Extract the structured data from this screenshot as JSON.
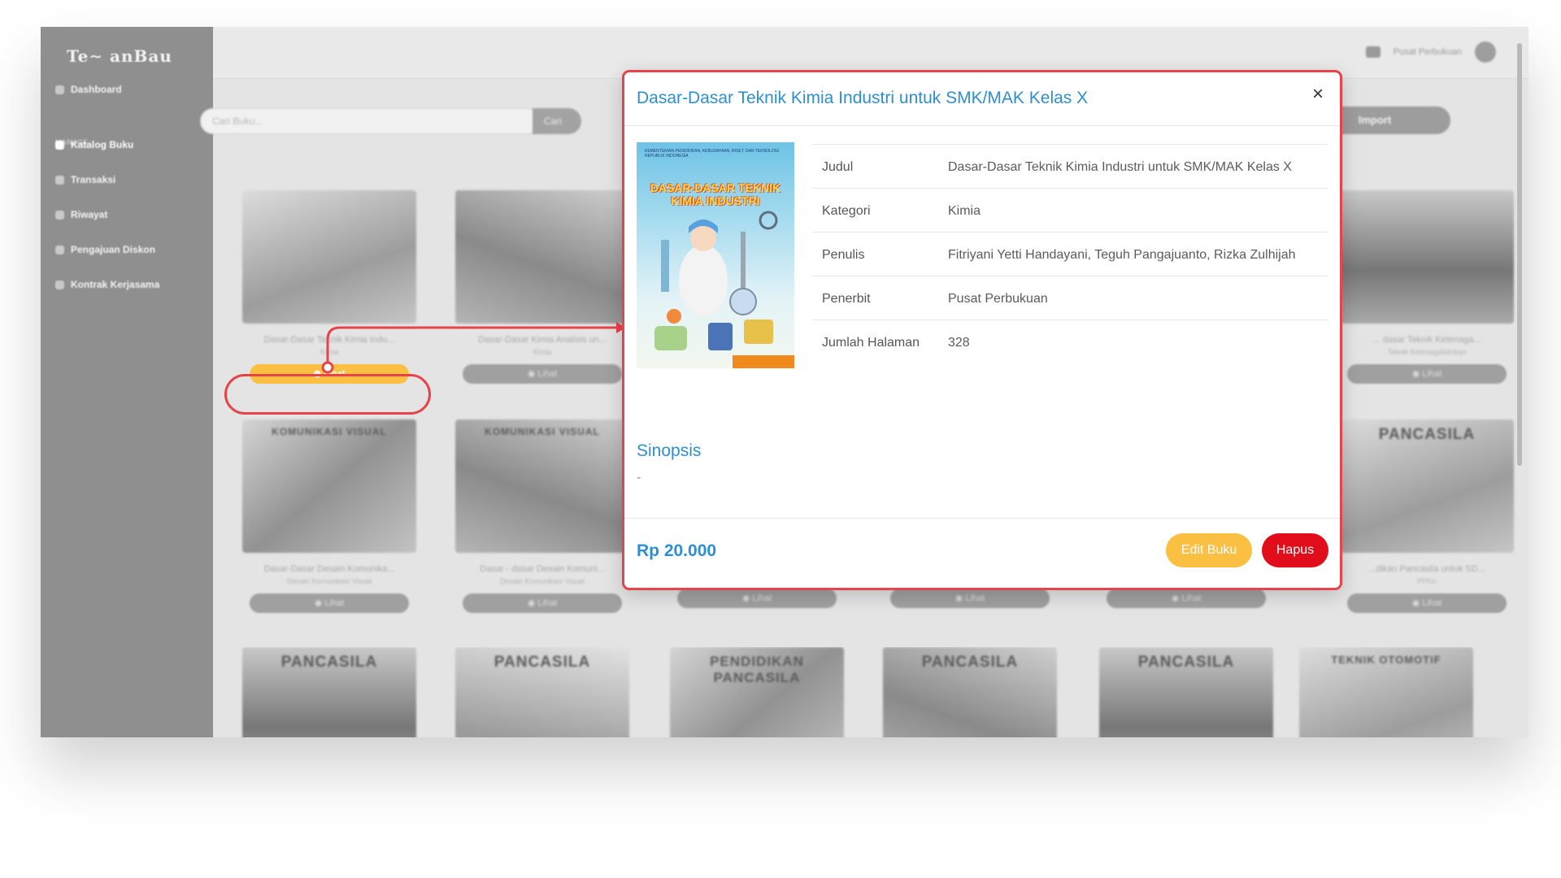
{
  "app": {
    "logo_text": "Te∼ anBau"
  },
  "sidebar": {
    "items": [
      {
        "label": "Dashboard",
        "active": false
      },
      {
        "label": "Katalog Buku",
        "active": true
      },
      {
        "label": "Transaksi",
        "active": false
      },
      {
        "label": "Riwayat",
        "active": false
      },
      {
        "label": "Pengajuan Diskon",
        "active": false
      },
      {
        "label": "Kontrak Kerjasama",
        "active": false
      }
    ],
    "section_label": "MANAGE"
  },
  "topbar": {
    "user_name": "Pusat Perbukuan"
  },
  "search": {
    "placeholder": "Cari Buku...",
    "button_label": "Cari"
  },
  "import_button": "Import",
  "cards": [
    {
      "title": "Dasar-Dasar Teknik Kimia Indu...",
      "category": "Kimia",
      "button": "Lihat",
      "highlighted": true
    },
    {
      "title": "Dasar-Dasar Kimia Analisis un...",
      "category": "Kimia",
      "button": "Lihat",
      "highlighted": false
    },
    {
      "title": "... dasar Teknik Ketenaga...",
      "category": "Teknik Ketenagalistrikan",
      "button": "Lihat",
      "highlighted": false
    },
    {
      "cover_label": "KOMUNIKASI VISUAL",
      "title": "Dasar-Dasar Desain Komunika...",
      "category": "Desain Komunikasi Visual",
      "button": "Lihat",
      "highlighted": false
    },
    {
      "cover_label": "KOMUNIKASI VISUAL",
      "title": "Dasar - dasar Desain Komuni...",
      "category": "Desain Komunikasi Visual",
      "button": "Lihat",
      "highlighted": false
    },
    {
      "title": "",
      "category": "",
      "button": "Lihat",
      "highlighted": false
    },
    {
      "title": "",
      "category": "",
      "button": "Lihat",
      "highlighted": false
    },
    {
      "title": "",
      "category": "",
      "button": "Lihat",
      "highlighted": false
    },
    {
      "cover_label": "PANCASILA",
      "title": "...dikan Pancasila untuk SD...",
      "category": "PPKn",
      "button": "Lihat",
      "highlighted": false
    },
    {
      "cover_label": "PANCASILA",
      "title": "",
      "category": "",
      "button": "",
      "highlighted": false
    },
    {
      "cover_label": "PANCASILA",
      "title": "",
      "category": "",
      "button": "",
      "highlighted": false
    },
    {
      "cover_label": "PENDIDIKAN PANCASILA",
      "title": "",
      "category": "",
      "button": "",
      "highlighted": false
    },
    {
      "cover_label": "PANCASILA",
      "title": "",
      "category": "",
      "button": "",
      "highlighted": false
    },
    {
      "cover_label": "PANCASILA",
      "title": "",
      "category": "",
      "button": "",
      "highlighted": false
    },
    {
      "cover_label": "TEKNIK OTOMOTIF",
      "title": "",
      "category": "",
      "button": "",
      "highlighted": false
    }
  ],
  "modal": {
    "title": "Dasar-Dasar Teknik Kimia Industri untuk SMK/MAK Kelas X",
    "close_icon": "×",
    "cover": {
      "publisher_line": "KEMENTERIAN PENDIDIKAN, KEBUDAYAAN, RISET, DAN TEKNOLOGI REPUBLIK INDONESIA",
      "cover_title": "DASAR-DASAR TEKNIK KIMIA INDUSTRI"
    },
    "details": [
      {
        "key": "Judul",
        "value": "Dasar-Dasar Teknik Kimia Industri untuk SMK/MAK Kelas X"
      },
      {
        "key": "Kategori",
        "value": "Kimia"
      },
      {
        "key": "Penulis",
        "value": "Fitriyani Yetti Handayani, Teguh Pangajuanto, Rizka Zulhijah"
      },
      {
        "key": "Penerbit",
        "value": "Pusat Perbukuan"
      },
      {
        "key": "Jumlah Halaman",
        "value": "328"
      }
    ],
    "sinopsis_heading": "Sinopsis",
    "sinopsis_text": "-",
    "price": "Rp 20.000",
    "edit_button": "Edit Buku",
    "delete_button": "Hapus"
  },
  "colors": {
    "accent": "#2e8fce",
    "highlight": "#e8434a",
    "warning": "#fbbf42",
    "danger": "#e10d1a"
  }
}
